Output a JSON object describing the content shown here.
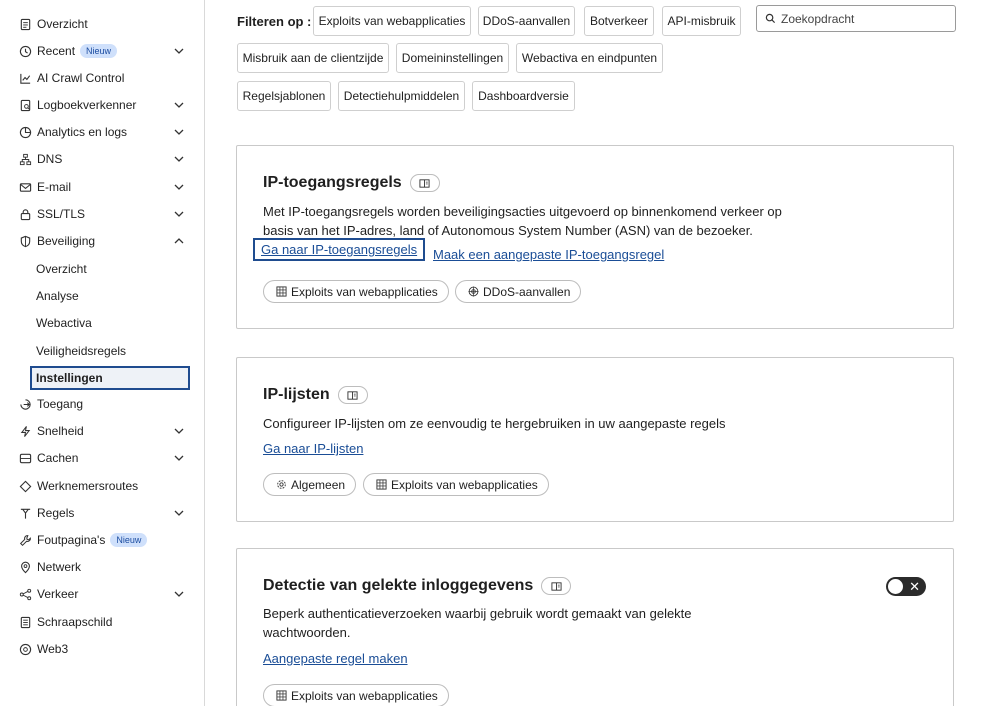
{
  "sidebar": {
    "items": [
      {
        "label": "Overzicht",
        "icon": "document-icon"
      },
      {
        "label": "Recent",
        "icon": "clock-icon",
        "badge": "Nieuw"
      },
      {
        "label": "AI Crawl Control",
        "icon": "chart-icon"
      },
      {
        "label": "Logboekverkenner",
        "icon": "log-icon"
      },
      {
        "label": "Analytics en logs",
        "icon": "pie-chart-icon"
      },
      {
        "label": "DNS",
        "icon": "network-tree-icon"
      },
      {
        "label": "E-mail",
        "icon": "email-icon"
      },
      {
        "label": "SSL/TLS",
        "icon": "lock-icon"
      },
      {
        "label": "Beveiliging",
        "icon": "shield-icon"
      },
      {
        "label": "Toegang",
        "icon": "access-icon"
      },
      {
        "label": "Snelheid",
        "icon": "lightning-icon"
      },
      {
        "label": "Cachen",
        "icon": "database-icon"
      },
      {
        "label": "Werknemersroutes",
        "icon": "diamond-icon"
      },
      {
        "label": "Regels",
        "icon": "rules-icon"
      },
      {
        "label": "Foutpagina's",
        "icon": "wrench-icon",
        "badge": "Nieuw"
      },
      {
        "label": "Netwerk",
        "icon": "location-pin-icon"
      },
      {
        "label": "Verkeer",
        "icon": "traffic-icon"
      },
      {
        "label": "Schraapschild",
        "icon": "scrape-shield-icon"
      },
      {
        "label": "Web3",
        "icon": "web3-icon"
      }
    ],
    "security_sub": [
      "Overzicht",
      "Analyse",
      "Webactiva",
      "Veiligheidsregels",
      "Instellingen"
    ]
  },
  "filters": {
    "label": "Filteren op :",
    "chips": [
      "Exploits van webapplicaties",
      "DDoS-aanvallen",
      "Botverkeer",
      "API-misbruik",
      "Misbruik aan de clientzijde",
      "Domeininstellingen",
      "Webactiva en eindpunten",
      "Regelsjablonen",
      "Detectiehulpmiddelen",
      "Dashboardversie"
    ],
    "search_placeholder": "Zoekopdracht"
  },
  "cards": {
    "ip_access": {
      "title": "IP-toegangsregels",
      "desc": "Met IP-toegangsregels worden beveiligingsacties uitgevoerd op binnenkomend verkeer op basis van het IP-adres, land of Autonomous System Number (ASN) van de bezoeker.",
      "link1": "Ga naar IP-toegangsregels",
      "link2": "Maak een aangepaste IP-toegangsregel",
      "tag1": "Exploits van webapplicaties",
      "tag2": "DDoS-aanvallen"
    },
    "ip_lists": {
      "title": "IP-lijsten",
      "desc": "Configureer IP-lijsten om ze eenvoudig te hergebruiken in uw aangepaste regels",
      "link1": "Ga naar IP-lijsten",
      "tag1": "Algemeen",
      "tag2": "Exploits van webapplicaties"
    },
    "leaked": {
      "title": "Detectie van gelekte inloggegevens",
      "desc": "Beperk authenticatieverzoeken waarbij gebruik wordt gemaakt van gelekte wachtwoorden.",
      "link1": "Aangepaste regel maken",
      "tag1": "Exploits van webapplicaties",
      "toggle_symbol": "✕"
    }
  }
}
